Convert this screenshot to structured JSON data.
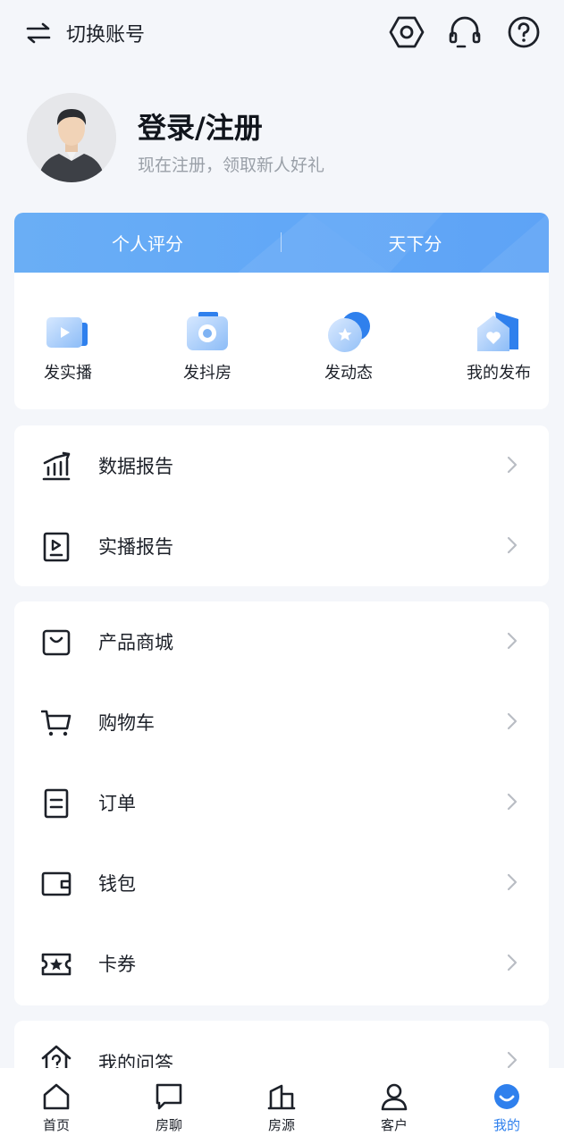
{
  "header": {
    "switch_label": "切换账号",
    "icons": [
      "swap-icon",
      "settings-hexagon-icon",
      "headset-icon",
      "help-icon"
    ]
  },
  "profile": {
    "login_label": "登录/注册",
    "subtitle": "现在注册，领取新人好礼"
  },
  "scores": {
    "personal": "个人评分",
    "tianxia": "天下分"
  },
  "actions": [
    {
      "label": "发实播",
      "icon": "video-camera-icon"
    },
    {
      "label": "发抖房",
      "icon": "camera-icon"
    },
    {
      "label": "发动态",
      "icon": "star-bubble-icon"
    },
    {
      "label": "我的发布",
      "icon": "house-heart-icon"
    }
  ],
  "reports": [
    {
      "label": "数据报告",
      "icon": "chart-icon"
    },
    {
      "label": "实播报告",
      "icon": "play-document-icon"
    }
  ],
  "shop": [
    {
      "label": "产品商城",
      "icon": "shopping-bag-icon"
    },
    {
      "label": "购物车",
      "icon": "cart-icon"
    },
    {
      "label": "订单",
      "icon": "order-document-icon"
    },
    {
      "label": "钱包",
      "icon": "wallet-icon"
    },
    {
      "label": "卡券",
      "icon": "coupon-icon"
    }
  ],
  "more": [
    {
      "label": "我的问答",
      "icon": "question-house-icon"
    }
  ],
  "tabs": [
    {
      "label": "首页",
      "icon": "home-icon",
      "active": false
    },
    {
      "label": "房聊",
      "icon": "chat-icon",
      "active": false
    },
    {
      "label": "房源",
      "icon": "building-icon",
      "active": false
    },
    {
      "label": "客户",
      "icon": "person-icon",
      "active": false
    },
    {
      "label": "我的",
      "icon": "smile-icon",
      "active": true
    }
  ],
  "colors": {
    "accent": "#2f80ed",
    "banner": "#62a8f7",
    "background": "#f4f6fa"
  }
}
